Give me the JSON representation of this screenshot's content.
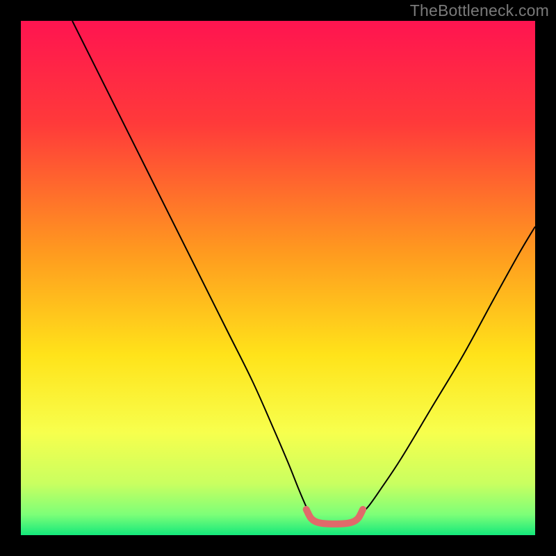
{
  "watermark": "TheBottleneck.com",
  "chart_data": {
    "type": "line",
    "title": "",
    "xlabel": "",
    "ylabel": "",
    "xlim": [
      0,
      100
    ],
    "ylim": [
      0,
      100
    ],
    "gradient_stops": [
      {
        "offset": 0.0,
        "color": "#ff1450"
      },
      {
        "offset": 0.2,
        "color": "#ff3a3a"
      },
      {
        "offset": 0.45,
        "color": "#ff9a1f"
      },
      {
        "offset": 0.65,
        "color": "#ffe31a"
      },
      {
        "offset": 0.8,
        "color": "#f7ff4d"
      },
      {
        "offset": 0.9,
        "color": "#c9ff60"
      },
      {
        "offset": 0.96,
        "color": "#7dff78"
      },
      {
        "offset": 1.0,
        "color": "#14e87b"
      }
    ],
    "series": [
      {
        "name": "left-curve",
        "stroke": "#000000",
        "stroke_width": 2,
        "points_xy": [
          [
            10,
            100
          ],
          [
            16,
            88
          ],
          [
            22,
            76
          ],
          [
            28,
            64
          ],
          [
            34,
            52
          ],
          [
            40,
            40
          ],
          [
            45,
            30
          ],
          [
            49,
            21
          ],
          [
            52,
            14
          ],
          [
            54,
            9
          ],
          [
            55.5,
            5.5
          ],
          [
            56.5,
            3.5
          ]
        ]
      },
      {
        "name": "right-curve",
        "stroke": "#000000",
        "stroke_width": 2,
        "points_xy": [
          [
            65.5,
            3.5
          ],
          [
            67.5,
            5.5
          ],
          [
            70,
            9
          ],
          [
            74,
            15
          ],
          [
            80,
            25
          ],
          [
            86,
            35
          ],
          [
            92,
            46
          ],
          [
            97,
            55
          ],
          [
            100,
            60
          ]
        ]
      },
      {
        "name": "sweet-spot",
        "stroke": "#e06a6a",
        "stroke_width": 10,
        "linecap": "round",
        "points_xy": [
          [
            55.5,
            5.0
          ],
          [
            56.5,
            3.2
          ],
          [
            58.0,
            2.4
          ],
          [
            60.0,
            2.2
          ],
          [
            62.0,
            2.2
          ],
          [
            64.0,
            2.4
          ],
          [
            65.5,
            3.2
          ],
          [
            66.5,
            5.0
          ]
        ]
      }
    ]
  }
}
